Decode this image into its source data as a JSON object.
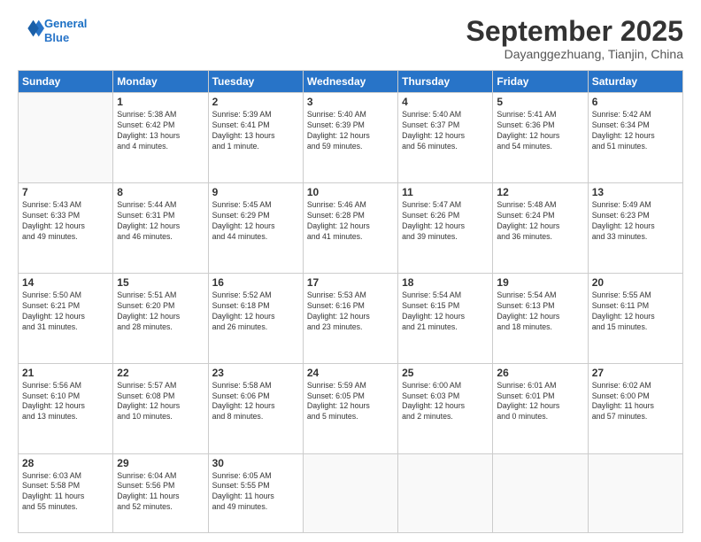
{
  "header": {
    "logo_line1": "General",
    "logo_line2": "Blue",
    "month": "September 2025",
    "location": "Dayanggezhuang, Tianjin, China"
  },
  "days_of_week": [
    "Sunday",
    "Monday",
    "Tuesday",
    "Wednesday",
    "Thursday",
    "Friday",
    "Saturday"
  ],
  "weeks": [
    [
      {
        "day": "",
        "info": ""
      },
      {
        "day": "1",
        "info": "Sunrise: 5:38 AM\nSunset: 6:42 PM\nDaylight: 13 hours\nand 4 minutes."
      },
      {
        "day": "2",
        "info": "Sunrise: 5:39 AM\nSunset: 6:41 PM\nDaylight: 13 hours\nand 1 minute."
      },
      {
        "day": "3",
        "info": "Sunrise: 5:40 AM\nSunset: 6:39 PM\nDaylight: 12 hours\nand 59 minutes."
      },
      {
        "day": "4",
        "info": "Sunrise: 5:40 AM\nSunset: 6:37 PM\nDaylight: 12 hours\nand 56 minutes."
      },
      {
        "day": "5",
        "info": "Sunrise: 5:41 AM\nSunset: 6:36 PM\nDaylight: 12 hours\nand 54 minutes."
      },
      {
        "day": "6",
        "info": "Sunrise: 5:42 AM\nSunset: 6:34 PM\nDaylight: 12 hours\nand 51 minutes."
      }
    ],
    [
      {
        "day": "7",
        "info": "Sunrise: 5:43 AM\nSunset: 6:33 PM\nDaylight: 12 hours\nand 49 minutes."
      },
      {
        "day": "8",
        "info": "Sunrise: 5:44 AM\nSunset: 6:31 PM\nDaylight: 12 hours\nand 46 minutes."
      },
      {
        "day": "9",
        "info": "Sunrise: 5:45 AM\nSunset: 6:29 PM\nDaylight: 12 hours\nand 44 minutes."
      },
      {
        "day": "10",
        "info": "Sunrise: 5:46 AM\nSunset: 6:28 PM\nDaylight: 12 hours\nand 41 minutes."
      },
      {
        "day": "11",
        "info": "Sunrise: 5:47 AM\nSunset: 6:26 PM\nDaylight: 12 hours\nand 39 minutes."
      },
      {
        "day": "12",
        "info": "Sunrise: 5:48 AM\nSunset: 6:24 PM\nDaylight: 12 hours\nand 36 minutes."
      },
      {
        "day": "13",
        "info": "Sunrise: 5:49 AM\nSunset: 6:23 PM\nDaylight: 12 hours\nand 33 minutes."
      }
    ],
    [
      {
        "day": "14",
        "info": "Sunrise: 5:50 AM\nSunset: 6:21 PM\nDaylight: 12 hours\nand 31 minutes."
      },
      {
        "day": "15",
        "info": "Sunrise: 5:51 AM\nSunset: 6:20 PM\nDaylight: 12 hours\nand 28 minutes."
      },
      {
        "day": "16",
        "info": "Sunrise: 5:52 AM\nSunset: 6:18 PM\nDaylight: 12 hours\nand 26 minutes."
      },
      {
        "day": "17",
        "info": "Sunrise: 5:53 AM\nSunset: 6:16 PM\nDaylight: 12 hours\nand 23 minutes."
      },
      {
        "day": "18",
        "info": "Sunrise: 5:54 AM\nSunset: 6:15 PM\nDaylight: 12 hours\nand 21 minutes."
      },
      {
        "day": "19",
        "info": "Sunrise: 5:54 AM\nSunset: 6:13 PM\nDaylight: 12 hours\nand 18 minutes."
      },
      {
        "day": "20",
        "info": "Sunrise: 5:55 AM\nSunset: 6:11 PM\nDaylight: 12 hours\nand 15 minutes."
      }
    ],
    [
      {
        "day": "21",
        "info": "Sunrise: 5:56 AM\nSunset: 6:10 PM\nDaylight: 12 hours\nand 13 minutes."
      },
      {
        "day": "22",
        "info": "Sunrise: 5:57 AM\nSunset: 6:08 PM\nDaylight: 12 hours\nand 10 minutes."
      },
      {
        "day": "23",
        "info": "Sunrise: 5:58 AM\nSunset: 6:06 PM\nDaylight: 12 hours\nand 8 minutes."
      },
      {
        "day": "24",
        "info": "Sunrise: 5:59 AM\nSunset: 6:05 PM\nDaylight: 12 hours\nand 5 minutes."
      },
      {
        "day": "25",
        "info": "Sunrise: 6:00 AM\nSunset: 6:03 PM\nDaylight: 12 hours\nand 2 minutes."
      },
      {
        "day": "26",
        "info": "Sunrise: 6:01 AM\nSunset: 6:01 PM\nDaylight: 12 hours\nand 0 minutes."
      },
      {
        "day": "27",
        "info": "Sunrise: 6:02 AM\nSunset: 6:00 PM\nDaylight: 11 hours\nand 57 minutes."
      }
    ],
    [
      {
        "day": "28",
        "info": "Sunrise: 6:03 AM\nSunset: 5:58 PM\nDaylight: 11 hours\nand 55 minutes."
      },
      {
        "day": "29",
        "info": "Sunrise: 6:04 AM\nSunset: 5:56 PM\nDaylight: 11 hours\nand 52 minutes."
      },
      {
        "day": "30",
        "info": "Sunrise: 6:05 AM\nSunset: 5:55 PM\nDaylight: 11 hours\nand 49 minutes."
      },
      {
        "day": "",
        "info": ""
      },
      {
        "day": "",
        "info": ""
      },
      {
        "day": "",
        "info": ""
      },
      {
        "day": "",
        "info": ""
      }
    ]
  ]
}
